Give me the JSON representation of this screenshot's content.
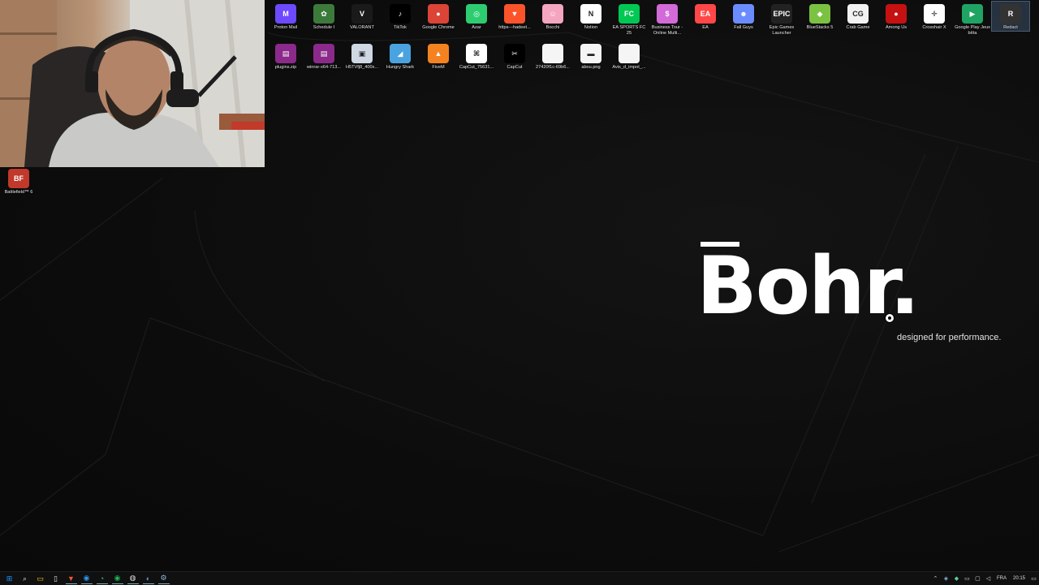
{
  "desktop": {
    "row1": [
      {
        "name": "Proton Mail",
        "icon": "proton-mail-icon",
        "color": "#6d4aff",
        "glyph": "M"
      },
      {
        "name": "Schedule I",
        "icon": "schedule-i-icon",
        "color": "#3c7a3c",
        "glyph": "✿"
      },
      {
        "name": "VALORANT",
        "icon": "valorant-icon",
        "color": "#1a1a1a",
        "glyph": "V"
      },
      {
        "name": "TikTok",
        "icon": "tiktok-icon",
        "color": "#000000",
        "glyph": "♪"
      },
      {
        "name": "Google Chrome",
        "icon": "chrome-icon",
        "color": "#db4437",
        "glyph": "●"
      },
      {
        "name": "Azar",
        "icon": "azar-icon",
        "color": "#2ecc71",
        "glyph": "◎"
      },
      {
        "name": "https---hadeet...",
        "icon": "brave-icon",
        "color": "#fb542b",
        "glyph": "▼"
      },
      {
        "name": "Bocchi",
        "icon": "bocchi-icon",
        "color": "#f4a6c0",
        "glyph": "☺"
      },
      {
        "name": "Notion",
        "icon": "notion-icon",
        "color": "#ffffff",
        "glyph": "N"
      },
      {
        "name": "EA SPORTS FC 25",
        "icon": "ea-fc-icon",
        "color": "#00c853",
        "glyph": "FC"
      },
      {
        "name": "Business Tour - Online Multi...",
        "icon": "business-tour-icon",
        "color": "#d26ad8",
        "glyph": "$"
      },
      {
        "name": "EA",
        "icon": "ea-icon",
        "color": "#ff4747",
        "glyph": "EA"
      },
      {
        "name": "Fall Guys",
        "icon": "fall-guys-icon",
        "color": "#6a8cff",
        "glyph": "☻"
      },
      {
        "name": "Epic Games Launcher",
        "icon": "epic-games-icon",
        "color": "#222222",
        "glyph": "EPIC"
      },
      {
        "name": "BlueStacks 5",
        "icon": "bluestacks-icon",
        "color": "#7cc242",
        "glyph": "◆"
      },
      {
        "name": "Crab Game",
        "icon": "crab-game-icon",
        "color": "#f2f2f2",
        "glyph": "CG"
      },
      {
        "name": "Among Us",
        "icon": "among-us-icon",
        "color": "#c51111",
        "glyph": "●"
      },
      {
        "name": "Crosshair X",
        "icon": "crosshair-x-icon",
        "color": "#ffffff",
        "glyph": "✛"
      },
      {
        "name": "Google Play Jeux bêta",
        "icon": "google-play-games-icon",
        "color": "#1fa463",
        "glyph": "▶"
      },
      {
        "name": "Redact",
        "icon": "redact-icon",
        "color": "#333333",
        "glyph": "R"
      }
    ],
    "row2": [
      {
        "name": "plugins.zip",
        "icon": "winrar-archive-icon",
        "color": "#8b2a8b",
        "glyph": "▤"
      },
      {
        "name": "winrar-x64-713...",
        "icon": "winrar-installer-icon",
        "color": "#8b2a8b",
        "glyph": "▤"
      },
      {
        "name": "H5TVfj8_400x...",
        "icon": "image-file-icon",
        "color": "#cfd8e3",
        "glyph": "▣"
      },
      {
        "name": "Hungry Shark",
        "icon": "hungry-shark-icon",
        "color": "#4aa3df",
        "glyph": "◢"
      },
      {
        "name": "FiveM",
        "icon": "fivem-icon",
        "color": "#f58220",
        "glyph": "▲"
      },
      {
        "name": "CapCut_75631...",
        "icon": "capcut-installer-icon",
        "color": "#ffffff",
        "glyph": "⌘"
      },
      {
        "name": "CapCut",
        "icon": "capcut-icon",
        "color": "#000000",
        "glyph": "✂"
      },
      {
        "name": "27420f1c-69b6...",
        "icon": "blank-file-icon",
        "color": "#f5f5f5",
        "glyph": ""
      },
      {
        "name": "abou.png",
        "icon": "png-file-icon",
        "color": "#f5f5f5",
        "glyph": "▬"
      },
      {
        "name": "Avis_d_impot_...",
        "icon": "document-file-icon",
        "color": "#f5f5f5",
        "glyph": ""
      }
    ],
    "extra": [
      {
        "name": "Battlefield™ 6",
        "icon": "battlefield-6-icon",
        "color": "#c0392b",
        "glyph": "BF"
      }
    ]
  },
  "wallpaper": {
    "brand": "Bohr",
    "brand_suffix": ".",
    "tagline": "designed for performance."
  },
  "taskbar": {
    "apps": [
      {
        "icon": "start-icon",
        "glyph": "⊞",
        "color": "#1e90ff"
      },
      {
        "icon": "search-icon",
        "glyph": "⌕",
        "color": "#dddddd"
      },
      {
        "icon": "file-explorer-icon",
        "glyph": "▭",
        "color": "#f3c623"
      },
      {
        "icon": "notepad-icon",
        "glyph": "▯",
        "color": "#dddddd"
      },
      {
        "icon": "brave-browser-icon",
        "glyph": "▼",
        "color": "#fb542b"
      },
      {
        "icon": "edge-icon",
        "glyph": "◉",
        "color": "#2b9af3"
      },
      {
        "icon": "whatsapp-icon",
        "glyph": "◔",
        "color": "#25d366"
      },
      {
        "icon": "spotify-icon",
        "glyph": "◉",
        "color": "#1db954"
      },
      {
        "icon": "obs-icon",
        "glyph": "◍",
        "color": "#dddddd"
      },
      {
        "icon": "discord-icon",
        "glyph": "◐",
        "color": "#7289da"
      },
      {
        "icon": "steam-icon",
        "glyph": "⚙",
        "color": "#8fb9e6"
      }
    ],
    "tray": {
      "language": "FRA",
      "time": "20:15"
    }
  }
}
